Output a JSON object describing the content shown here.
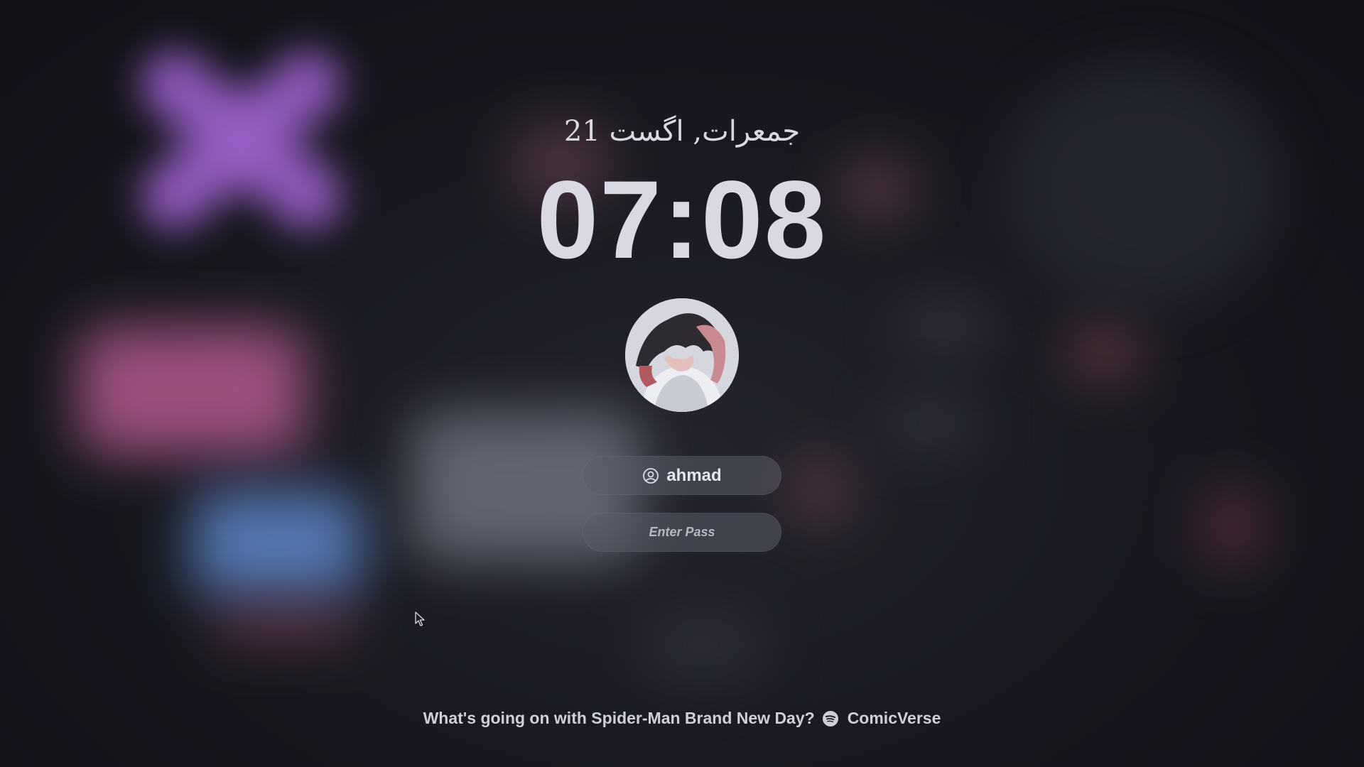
{
  "lockscreen": {
    "date": "جمعرات, اگست 21",
    "time": "07:08"
  },
  "user": {
    "username": "ahmad",
    "icon": "user-circle-icon"
  },
  "password": {
    "placeholder": "Enter Pass",
    "value": ""
  },
  "now_playing": {
    "title": "What's going on with Spider-Man Brand New Day?",
    "source_icon": "spotify-icon",
    "source": "ComicVerse"
  },
  "colors": {
    "background": "#14151c",
    "text": "#d9d9e4",
    "pill": "#5a5c68"
  }
}
